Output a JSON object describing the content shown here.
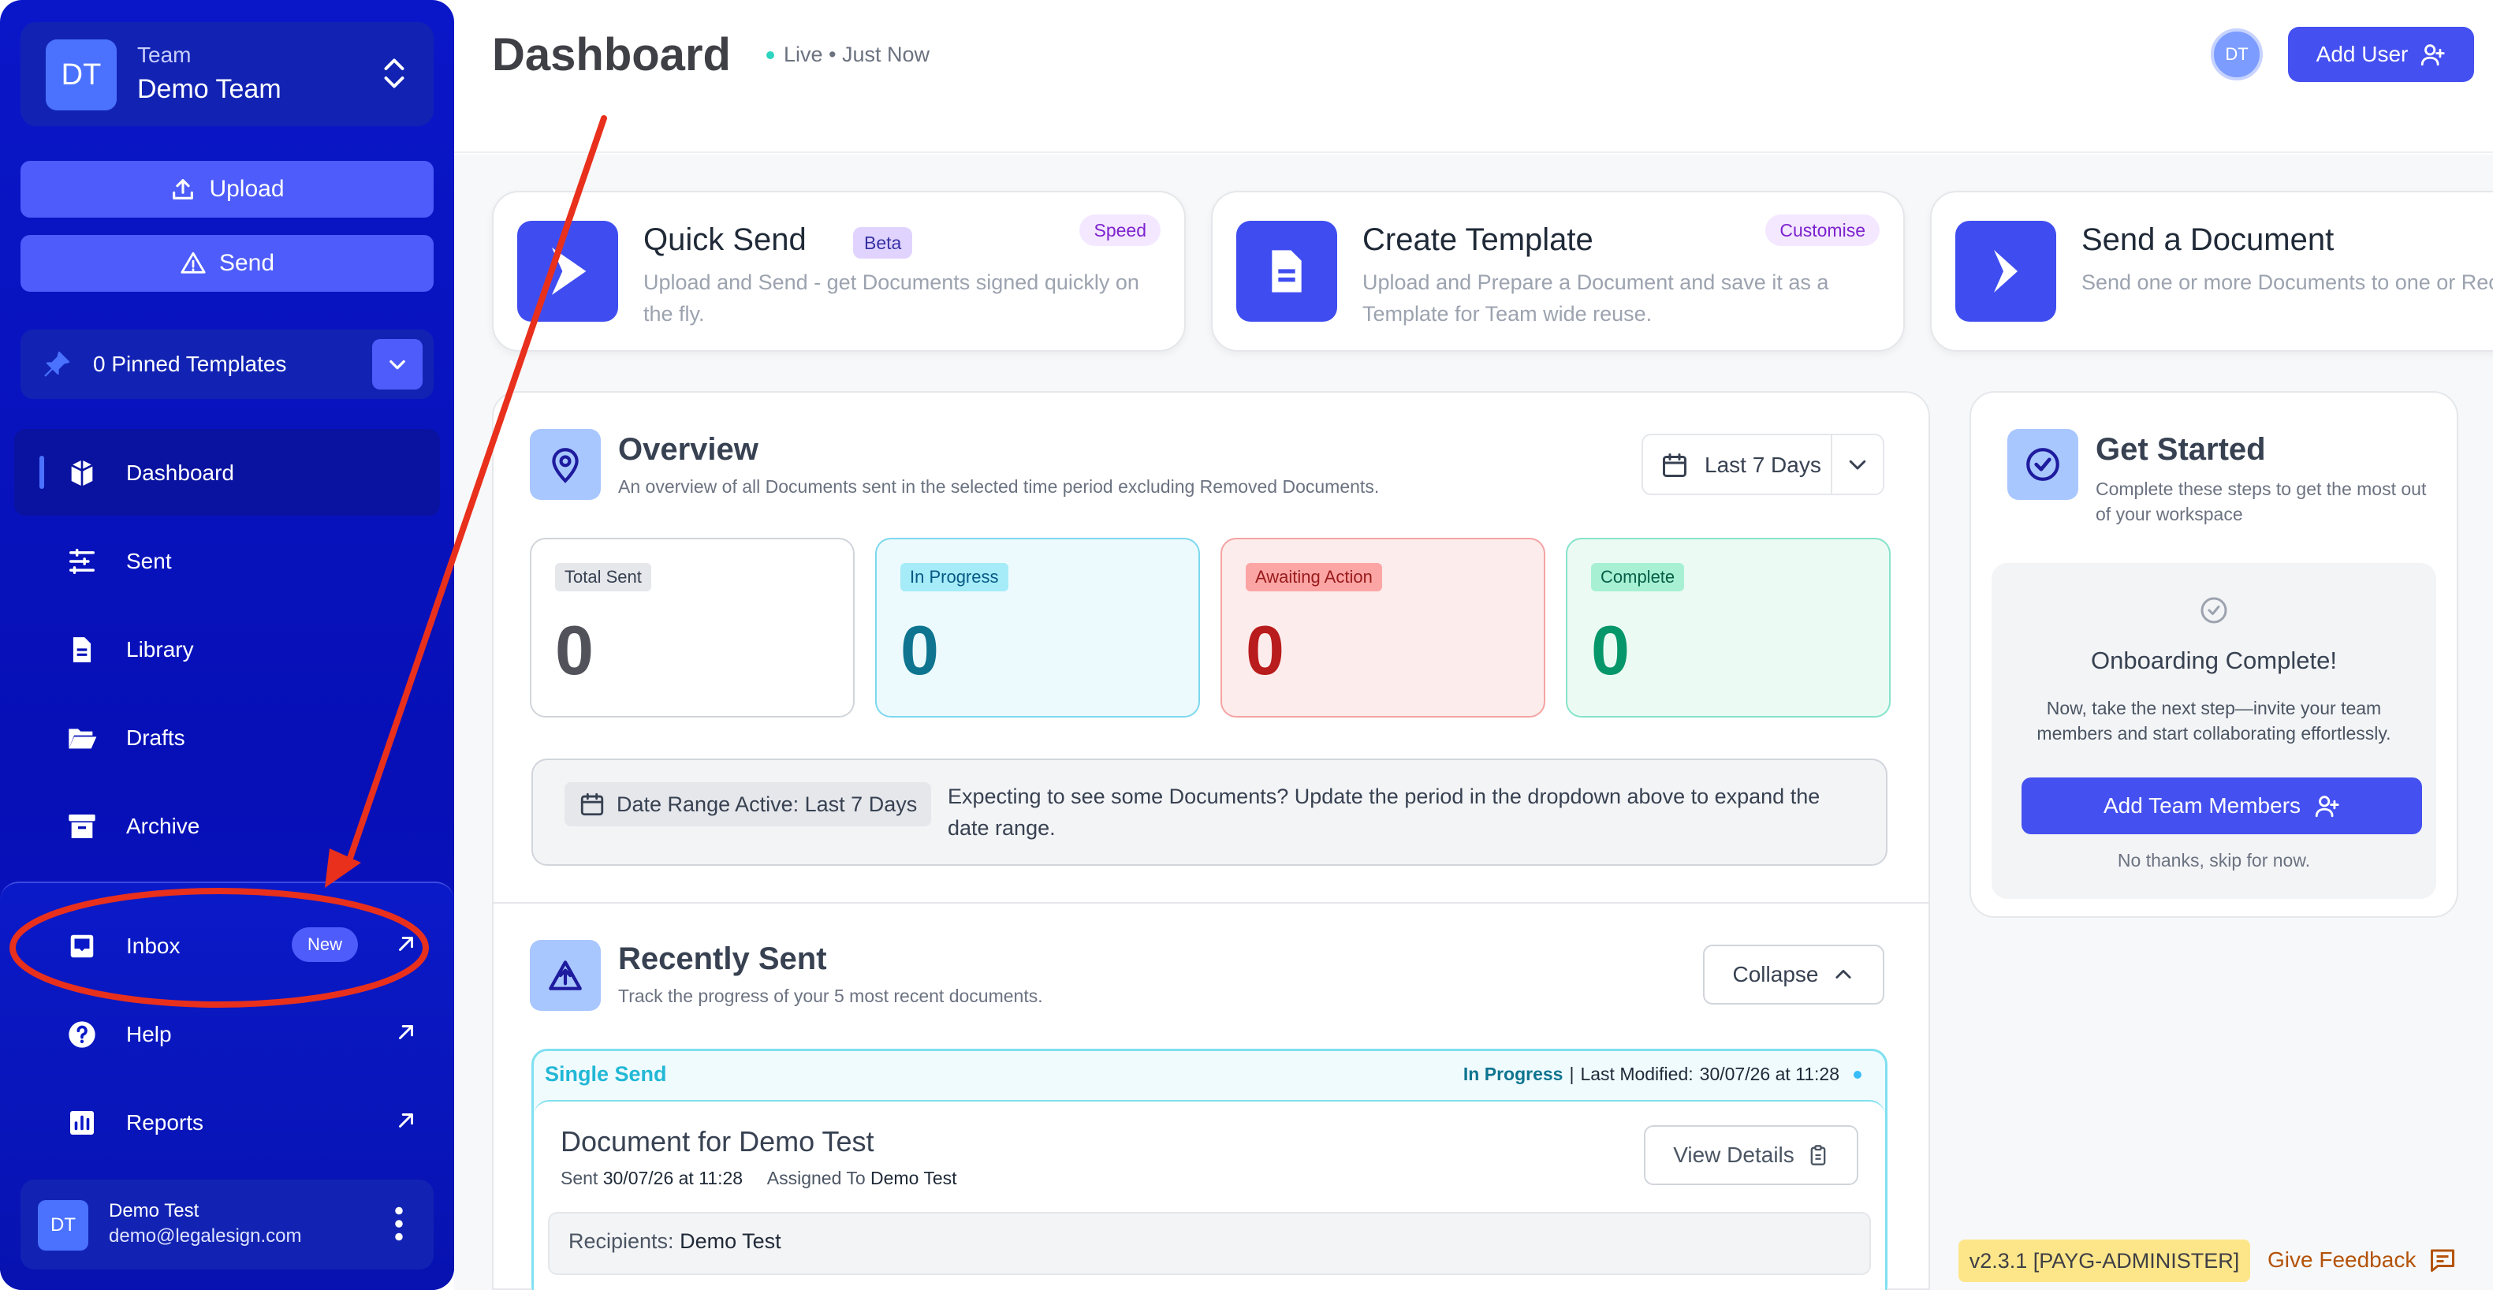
{
  "sidebar": {
    "team": {
      "label": "Team",
      "name": "Demo Team",
      "initials": "DT"
    },
    "upload_label": "Upload",
    "send_label": "Send",
    "pinned_label": "0 Pinned Templates",
    "nav": [
      {
        "label": "Dashboard"
      },
      {
        "label": "Sent"
      },
      {
        "label": "Library"
      },
      {
        "label": "Drafts"
      },
      {
        "label": "Archive"
      }
    ],
    "bottom": [
      {
        "label": "Inbox",
        "badge": "New"
      },
      {
        "label": "Help"
      },
      {
        "label": "Reports"
      }
    ],
    "user": {
      "initials": "DT",
      "name": "Demo Test",
      "email": "demo@legalesign.com"
    }
  },
  "header": {
    "title": "Dashboard",
    "live": "Live • Just Now",
    "avatar": "DT",
    "add_user": "Add User"
  },
  "quick_cards": [
    {
      "title": "Quick Send",
      "badge": "Beta",
      "tag": "Speed",
      "desc": "Upload and Send - get Documents signed quickly on the fly."
    },
    {
      "title": "Create Template",
      "tag": "Customise",
      "desc": "Upload and Prepare a Document and save it as a Template for Team wide reuse."
    },
    {
      "title": "Send a Document",
      "desc": "Send one or more Documents to one or Recipients."
    }
  ],
  "overview": {
    "title": "Overview",
    "desc": "An overview of all Documents sent in the selected time period excluding Removed Documents.",
    "range": "Last 7 Days",
    "stats": [
      {
        "label": "Total Sent",
        "value": "0"
      },
      {
        "label": "In Progress",
        "value": "0"
      },
      {
        "label": "Awaiting Action",
        "value": "0"
      },
      {
        "label": "Complete",
        "value": "0"
      }
    ],
    "note_chip": "Date Range Active: Last 7 Days",
    "note_text": "Expecting to see some Documents? Update the period in the dropdown above to expand the date range."
  },
  "recent": {
    "title": "Recently Sent",
    "desc": "Track the progress of your 5 most recent documents.",
    "collapse": "Collapse",
    "item": {
      "type": "Single Send",
      "status": "In Progress",
      "sep": "|",
      "modified_label": "Last Modified:",
      "modified": "30/07/26 at 11:28",
      "doc_title": "Document for Demo Test",
      "sent_label": "Sent",
      "sent": "30/07/26 at 11:28",
      "assigned_label": "Assigned To",
      "assigned": "Demo Test",
      "view": "View Details",
      "recipients_label": "Recipients:",
      "recipients": "Demo Test"
    }
  },
  "get_started": {
    "title": "Get Started",
    "desc": "Complete these steps to get the most out of your workspace",
    "done_title": "Onboarding Complete!",
    "done_desc": "Now, take the next step—invite your team members and start collaborating effortlessly.",
    "button": "Add Team Members",
    "skip": "No thanks, skip for now."
  },
  "footer": {
    "version": "v2.3.1 [PAYG-ADMINISTER]",
    "feedback": "Give Feedback"
  },
  "colors": {
    "sidebar": "#0a17c8",
    "accent": "#4450f0",
    "annotation": "#e8301c"
  }
}
